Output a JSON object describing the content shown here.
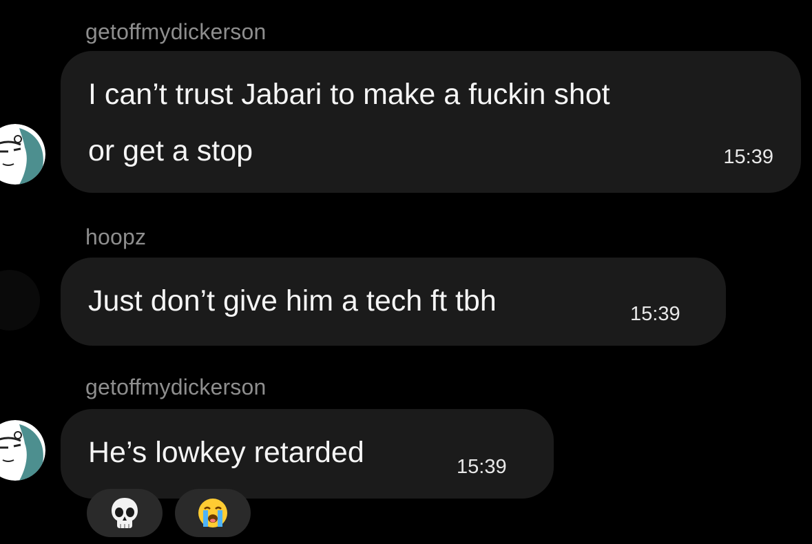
{
  "conversation": {
    "messages": [
      {
        "sender": "getoffmydickerson",
        "text_lines": [
          "I can’t trust Jabari to make a fuckin shot",
          "or get a stop"
        ],
        "time": "15:39"
      },
      {
        "sender": "hoopz",
        "text_lines": [
          "Just don’t give him a tech ft tbh"
        ],
        "time": "15:39"
      },
      {
        "sender": "getoffmydickerson",
        "text_lines": [
          "He’s lowkey retarded"
        ],
        "time": "15:39",
        "reactions": [
          {
            "emoji": "💀",
            "icon": "skull-icon"
          },
          {
            "emoji": "😭",
            "icon": "loudly-crying-face-icon"
          }
        ]
      }
    ]
  },
  "colors": {
    "background": "#000000",
    "bubble": "#1b1b1b",
    "sender_name": "#8e8e8e",
    "message_text": "#f5f5f5",
    "reaction_pill": "#2a2a2a"
  }
}
